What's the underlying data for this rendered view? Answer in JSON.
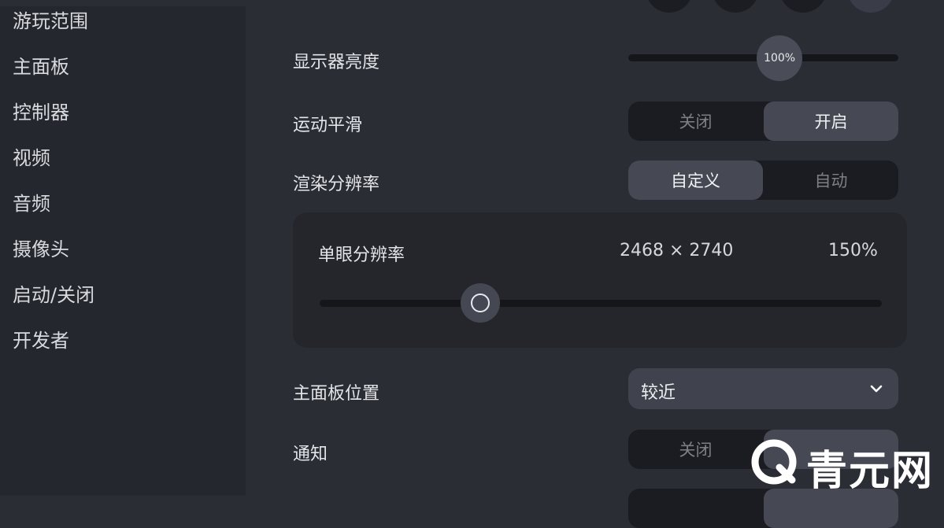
{
  "sidebar": {
    "items": [
      {
        "label": "游玩范围"
      },
      {
        "label": "主面板"
      },
      {
        "label": "控制器"
      },
      {
        "label": "视频"
      },
      {
        "label": "音频"
      },
      {
        "label": "摄像头"
      },
      {
        "label": "启动/关闭"
      },
      {
        "label": "开发者"
      }
    ]
  },
  "settings": {
    "brightness": {
      "label": "显示器亮度",
      "value_text": "100%",
      "level_percent": 100
    },
    "motion_smoothing": {
      "label": "运动平滑",
      "off": "关闭",
      "on": "开启",
      "selected": "开启"
    },
    "render_resolution": {
      "label": "渲染分辨率",
      "custom": "自定义",
      "auto": "自动",
      "selected": "自定义"
    },
    "per_eye_resolution": {
      "label": "单眼分辨率",
      "resolution": "2468 × 2740",
      "percent": "150%"
    },
    "home_position": {
      "label": "主面板位置",
      "value": "较近"
    },
    "notifications": {
      "label": "通知",
      "off": "关闭"
    }
  },
  "watermark": {
    "text": "青元网"
  },
  "colors": {
    "background": "#2b2d35",
    "sidebar": "#25272e",
    "active_segment": "#464954",
    "track": "#15161a"
  }
}
